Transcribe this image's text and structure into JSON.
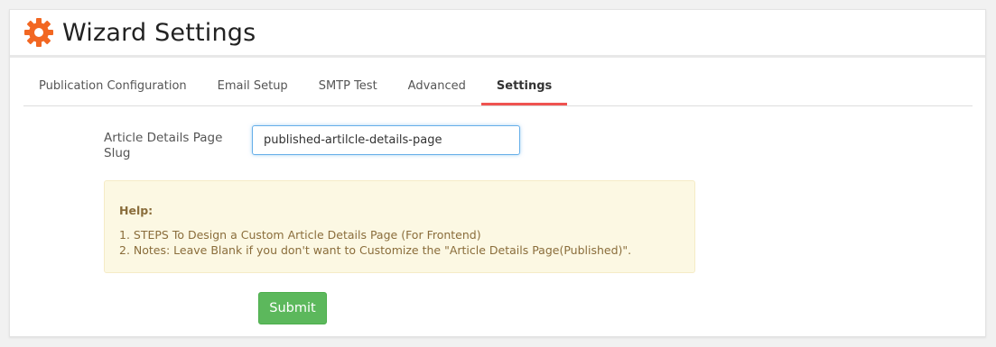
{
  "header": {
    "title": "Wizard Settings",
    "icon": "gear-icon",
    "icon_color": "#f26722"
  },
  "tabs": [
    {
      "label": "Publication Configuration",
      "active": false
    },
    {
      "label": "Email Setup",
      "active": false
    },
    {
      "label": "SMTP Test",
      "active": false
    },
    {
      "label": "Advanced",
      "active": false
    },
    {
      "label": "Settings",
      "active": true
    }
  ],
  "form": {
    "slug_label": "Article Details Page Slug",
    "slug_value": "published-artilcle-details-page"
  },
  "help": {
    "title": "Help:",
    "lines": [
      "1. STEPS To Design a Custom Article Details Page (For Frontend)",
      "2. Notes: Leave Blank if you don't want to Customize the \"Article Details Page(Published)\"."
    ]
  },
  "submit_label": "Submit",
  "colors": {
    "active_tab_underline": "#ef5350",
    "submit_bg": "#5cb85c",
    "help_bg": "#fcf8e3",
    "help_text": "#8a6d3b"
  }
}
